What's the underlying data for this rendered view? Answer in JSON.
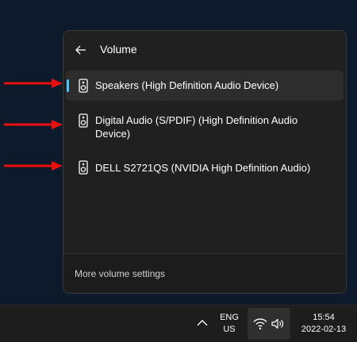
{
  "flyout": {
    "title": "Volume",
    "back_icon": "arrow-left-icon",
    "devices": [
      {
        "label": "Speakers (High Definition Audio Device)",
        "selected": true,
        "icon": "speaker-icon"
      },
      {
        "label": "Digital Audio (S/PDIF) (High Definition Audio Device)",
        "selected": false,
        "icon": "speaker-icon"
      },
      {
        "label": "DELL S2721QS (NVIDIA High Definition Audio)",
        "selected": false,
        "icon": "speaker-icon"
      }
    ],
    "more_settings_label": "More volume settings"
  },
  "taskbar": {
    "language_line1": "ENG",
    "language_line2": "US",
    "time": "15:54",
    "date": "2022-02-13",
    "tray_icons": [
      "chevron-up-icon",
      "wifi-icon",
      "volume-icon"
    ]
  },
  "colors": {
    "accent": "#4cc2ff",
    "annotation_arrow": "#e8100f",
    "flyout_bg": "#202020",
    "desktop_bg": "#0c1a2b"
  }
}
